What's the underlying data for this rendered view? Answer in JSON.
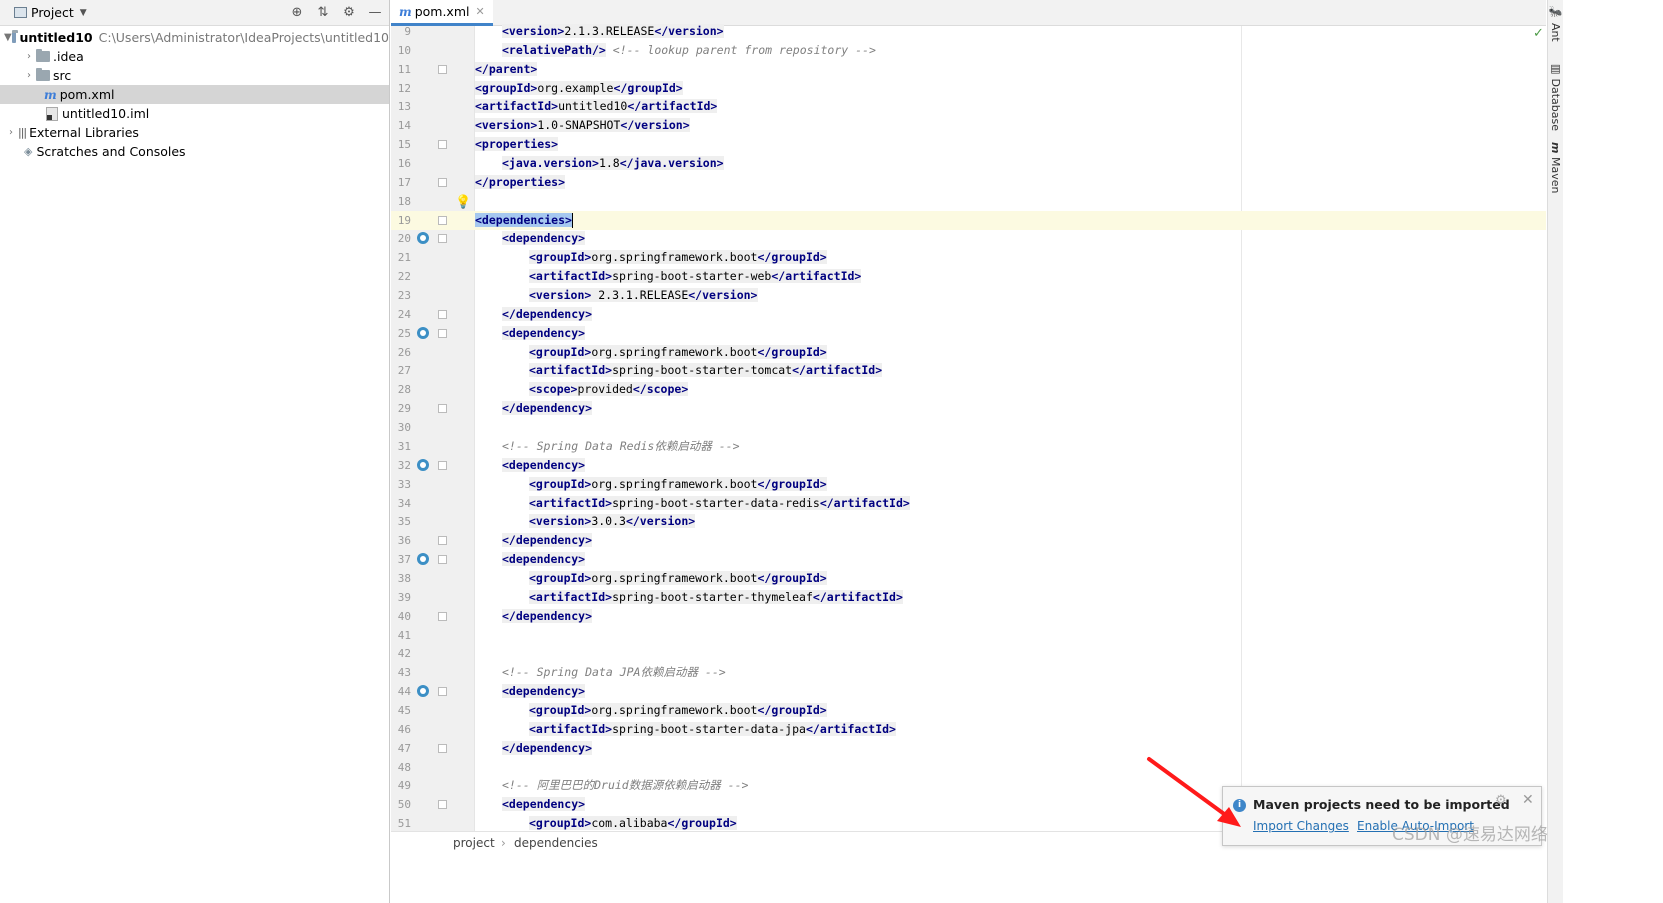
{
  "project_panel": {
    "title": "Project",
    "tree": [
      {
        "label": "untitled10",
        "path": "C:\\Users\\Administrator\\IdeaProjects\\untitled10",
        "type": "module",
        "expanded": true
      },
      {
        "label": ".idea",
        "type": "folder"
      },
      {
        "label": "src",
        "type": "folder"
      },
      {
        "label": "pom.xml",
        "type": "maven-file",
        "selected": true
      },
      {
        "label": "untitled10.iml",
        "type": "iml-file"
      },
      {
        "label": "External Libraries",
        "type": "library"
      },
      {
        "label": "Scratches and Consoles",
        "type": "scratches"
      }
    ]
  },
  "editor": {
    "tab_label": "pom.xml",
    "lines": [
      {
        "n": "9",
        "indent": 1,
        "parts": [
          [
            "tag",
            "<version>"
          ],
          [
            "txt",
            "2.1.3.RELEASE"
          ],
          [
            "tag",
            "</version>"
          ]
        ]
      },
      {
        "n": "10",
        "indent": 1,
        "parts": [
          [
            "tag",
            "<relativePath/>"
          ],
          [
            "plain",
            " "
          ],
          [
            "comment",
            "<!-- lookup parent from repository -->"
          ]
        ]
      },
      {
        "n": "11",
        "indent": 0,
        "parts": [
          [
            "tag",
            "</parent>"
          ]
        ],
        "fold": true
      },
      {
        "n": "12",
        "indent": 0,
        "parts": [
          [
            "tag",
            "<groupId>"
          ],
          [
            "txt",
            "org.example"
          ],
          [
            "tag",
            "</groupId>"
          ]
        ]
      },
      {
        "n": "13",
        "indent": 0,
        "parts": [
          [
            "tag",
            "<artifactId>"
          ],
          [
            "txt",
            "untitled10"
          ],
          [
            "tag",
            "</artifactId>"
          ]
        ]
      },
      {
        "n": "14",
        "indent": 0,
        "parts": [
          [
            "tag",
            "<version>"
          ],
          [
            "txt",
            "1.0-SNAPSHOT"
          ],
          [
            "tag",
            "</version>"
          ]
        ]
      },
      {
        "n": "15",
        "indent": 0,
        "parts": [
          [
            "tag",
            "<properties>"
          ]
        ],
        "fold": true
      },
      {
        "n": "16",
        "indent": 1,
        "parts": [
          [
            "tag",
            "<java.version>"
          ],
          [
            "txt",
            "1.8"
          ],
          [
            "tag",
            "</java.version>"
          ]
        ]
      },
      {
        "n": "17",
        "indent": 0,
        "parts": [
          [
            "tag",
            "</properties>"
          ]
        ],
        "fold": true
      },
      {
        "n": "18",
        "indent": 0,
        "parts": [],
        "bulb": true
      },
      {
        "n": "19",
        "indent": 0,
        "parts": [
          [
            "hl",
            "<dependencies>"
          ]
        ],
        "fold": true,
        "current": true,
        "caret": true
      },
      {
        "n": "20",
        "indent": 1,
        "parts": [
          [
            "tag",
            "<dependency>"
          ]
        ],
        "fold": true,
        "gicon": true
      },
      {
        "n": "21",
        "indent": 2,
        "parts": [
          [
            "tag",
            "<groupId>"
          ],
          [
            "txt",
            "org.springframework.boot"
          ],
          [
            "tag",
            "</groupId>"
          ]
        ]
      },
      {
        "n": "22",
        "indent": 2,
        "parts": [
          [
            "tag",
            "<artifactId>"
          ],
          [
            "txt",
            "spring-boot-starter-web"
          ],
          [
            "tag",
            "</artifactId>"
          ]
        ]
      },
      {
        "n": "23",
        "indent": 2,
        "parts": [
          [
            "tag",
            "<version>"
          ],
          [
            "txt",
            " 2.3.1.RELEASE"
          ],
          [
            "tag",
            "</version>"
          ]
        ]
      },
      {
        "n": "24",
        "indent": 1,
        "parts": [
          [
            "tag",
            "</dependency>"
          ]
        ],
        "fold": true
      },
      {
        "n": "25",
        "indent": 1,
        "parts": [
          [
            "tag",
            "<dependency>"
          ]
        ],
        "fold": true,
        "gicon": true
      },
      {
        "n": "26",
        "indent": 2,
        "parts": [
          [
            "tag",
            "<groupId>"
          ],
          [
            "txt",
            "org.springframework.boot"
          ],
          [
            "tag",
            "</groupId>"
          ]
        ]
      },
      {
        "n": "27",
        "indent": 2,
        "parts": [
          [
            "tag",
            "<artifactId>"
          ],
          [
            "txt",
            "spring-boot-starter-tomcat"
          ],
          [
            "tag",
            "</artifactId>"
          ]
        ]
      },
      {
        "n": "28",
        "indent": 2,
        "parts": [
          [
            "tag",
            "<scope>"
          ],
          [
            "txt",
            "provided"
          ],
          [
            "tag",
            "</scope>"
          ]
        ]
      },
      {
        "n": "29",
        "indent": 1,
        "parts": [
          [
            "tag",
            "</dependency>"
          ]
        ],
        "fold": true
      },
      {
        "n": "30",
        "indent": 0,
        "parts": []
      },
      {
        "n": "31",
        "indent": 1,
        "parts": [
          [
            "comment",
            "<!-- Spring Data Redis依赖启动器 -->"
          ]
        ]
      },
      {
        "n": "32",
        "indent": 1,
        "parts": [
          [
            "tag",
            "<dependency>"
          ]
        ],
        "fold": true,
        "gicon": true
      },
      {
        "n": "33",
        "indent": 2,
        "parts": [
          [
            "tag",
            "<groupId>"
          ],
          [
            "txt",
            "org.springframework.boot"
          ],
          [
            "tag",
            "</groupId>"
          ]
        ]
      },
      {
        "n": "34",
        "indent": 2,
        "parts": [
          [
            "tag",
            "<artifactId>"
          ],
          [
            "txt",
            "spring-boot-starter-data-redis"
          ],
          [
            "tag",
            "</artifactId>"
          ]
        ]
      },
      {
        "n": "35",
        "indent": 2,
        "parts": [
          [
            "tag",
            "<version>"
          ],
          [
            "txt",
            "3.0.3"
          ],
          [
            "tag",
            "</version>"
          ]
        ]
      },
      {
        "n": "36",
        "indent": 1,
        "parts": [
          [
            "tag",
            "</dependency>"
          ]
        ],
        "fold": true
      },
      {
        "n": "37",
        "indent": 1,
        "parts": [
          [
            "tag",
            "<dependency>"
          ]
        ],
        "fold": true,
        "gicon": true
      },
      {
        "n": "38",
        "indent": 2,
        "parts": [
          [
            "tag",
            "<groupId>"
          ],
          [
            "txt",
            "org.springframework.boot"
          ],
          [
            "tag",
            "</groupId>"
          ]
        ]
      },
      {
        "n": "39",
        "indent": 2,
        "parts": [
          [
            "tag",
            "<artifactId>"
          ],
          [
            "txt",
            "spring-boot-starter-thymeleaf"
          ],
          [
            "tag",
            "</artifactId>"
          ]
        ]
      },
      {
        "n": "40",
        "indent": 1,
        "parts": [
          [
            "tag",
            "</dependency>"
          ]
        ],
        "fold": true
      },
      {
        "n": "41",
        "indent": 0,
        "parts": []
      },
      {
        "n": "42",
        "indent": 0,
        "parts": []
      },
      {
        "n": "43",
        "indent": 1,
        "parts": [
          [
            "comment",
            "<!-- Spring Data JPA依赖启动器 -->"
          ]
        ]
      },
      {
        "n": "44",
        "indent": 1,
        "parts": [
          [
            "tag",
            "<dependency>"
          ]
        ],
        "fold": true,
        "gicon": true
      },
      {
        "n": "45",
        "indent": 2,
        "parts": [
          [
            "tag",
            "<groupId>"
          ],
          [
            "txt",
            "org.springframework.boot"
          ],
          [
            "tag",
            "</groupId>"
          ]
        ]
      },
      {
        "n": "46",
        "indent": 2,
        "parts": [
          [
            "tag",
            "<artifactId>"
          ],
          [
            "txt",
            "spring-boot-starter-data-jpa"
          ],
          [
            "tag",
            "</artifactId>"
          ]
        ]
      },
      {
        "n": "47",
        "indent": 1,
        "parts": [
          [
            "tag",
            "</dependency>"
          ]
        ],
        "fold": true
      },
      {
        "n": "48",
        "indent": 0,
        "parts": []
      },
      {
        "n": "49",
        "indent": 1,
        "parts": [
          [
            "comment",
            "<!-- 阿里巴巴的Druid数据源依赖启动器 -->"
          ]
        ]
      },
      {
        "n": "50",
        "indent": 1,
        "parts": [
          [
            "tag",
            "<dependency>"
          ]
        ],
        "fold": true
      },
      {
        "n": "51",
        "indent": 2,
        "parts": [
          [
            "tag",
            "<groupId>"
          ],
          [
            "txt",
            "com.alibaba"
          ],
          [
            "tag",
            "</groupId>"
          ]
        ]
      }
    ],
    "breadcrumbs": [
      "project",
      "dependencies"
    ]
  },
  "right_strip": [
    "Ant",
    "Database",
    "Maven"
  ],
  "notification": {
    "title": "Maven projects need to be imported",
    "import_label": "Import Changes",
    "auto_import_label": "Enable Auto-Import"
  },
  "watermark": "CSDN @速易达网络",
  "colors": {
    "tag": "#000080",
    "comment": "#808080",
    "link": "#2470b3",
    "selection": "#a6c8ef",
    "current_line": "#fcfae1"
  }
}
